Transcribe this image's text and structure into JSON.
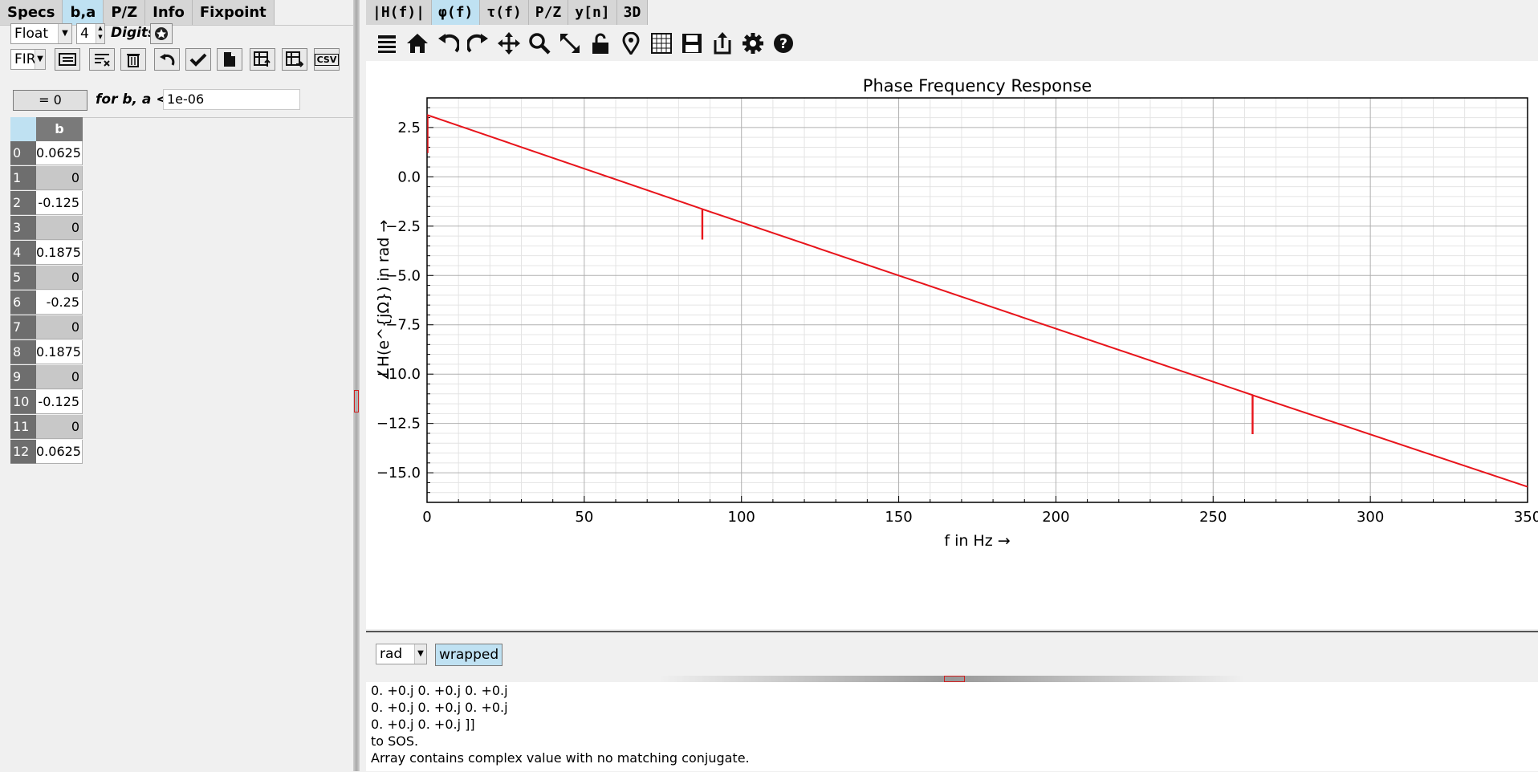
{
  "left_tabs": [
    {
      "label": "Specs",
      "active": false
    },
    {
      "label": "b,a",
      "active": true
    },
    {
      "label": "P/Z",
      "active": false
    },
    {
      "label": "Info",
      "active": false
    },
    {
      "label": "Fixpoint",
      "active": false
    }
  ],
  "format": {
    "selected": "Float",
    "digits": "4",
    "digits_label": "Digits"
  },
  "filter_type": {
    "selected": "FIR"
  },
  "zero": {
    "button_label": "= 0",
    "threshold_label": "for b, a <",
    "threshold_value": "1e-06",
    "csv_label": "CSV"
  },
  "coef_table": {
    "header": "b",
    "rows": [
      {
        "idx": "0",
        "b": "0.0625"
      },
      {
        "idx": "1",
        "b": "0"
      },
      {
        "idx": "2",
        "b": "-0.125"
      },
      {
        "idx": "3",
        "b": "0"
      },
      {
        "idx": "4",
        "b": "0.1875"
      },
      {
        "idx": "5",
        "b": "0"
      },
      {
        "idx": "6",
        "b": "-0.25"
      },
      {
        "idx": "7",
        "b": "0"
      },
      {
        "idx": "8",
        "b": "0.1875"
      },
      {
        "idx": "9",
        "b": "0"
      },
      {
        "idx": "10",
        "b": "-0.125"
      },
      {
        "idx": "11",
        "b": "0"
      },
      {
        "idx": "12",
        "b": "0.0625"
      }
    ]
  },
  "right_tabs": [
    {
      "label": "|H(f)|",
      "active": false
    },
    {
      "label": "φ(f)",
      "active": true
    },
    {
      "label": "τ(f)",
      "active": false
    },
    {
      "label": "P/Z",
      "active": false
    },
    {
      "label": "y[n]",
      "active": false
    },
    {
      "label": "3D",
      "active": false
    }
  ],
  "toolbar_icons": [
    "menu-icon",
    "home-icon",
    "undo-icon",
    "redo-icon",
    "pan-icon",
    "zoom-icon",
    "fullscreen-icon",
    "lock-icon",
    "pin-icon",
    "grid-icon",
    "save-icon",
    "export-icon",
    "settings-icon",
    "help-icon"
  ],
  "chart_data": {
    "type": "line",
    "title": "Phase Frequency Response",
    "xlabel": "f in Hz →",
    "ylabel": "∠H(e^{jΩ}) in rad →",
    "xlim": [
      0,
      350
    ],
    "ylim": [
      -16.5,
      4.0
    ],
    "xticks": [
      "0",
      "50",
      "100",
      "150",
      "200",
      "250",
      "300",
      "350"
    ],
    "yticks": [
      "2.5",
      "0.0",
      "−2.5",
      "−5.0",
      "−7.5",
      "−10.0",
      "−12.5",
      "−15.0"
    ],
    "grid": true,
    "series": [
      {
        "color": "#e8141b",
        "x": [
          0,
          87.5,
          87.5,
          87.6,
          87.6,
          262.5,
          262.5,
          262.6,
          262.6,
          350
        ],
        "y": [
          3.14,
          -1.63,
          -3.14,
          -3.14,
          -1.64,
          -11.06,
          -13.0,
          -13.0,
          -11.07,
          -15.71
        ]
      }
    ]
  },
  "options": {
    "unit": "rad",
    "wrapped_label": "wrapped"
  },
  "console_lines": [
    "0. +0.j 0. +0.j 0. +0.j",
    "0. +0.j 0. +0.j 0. +0.j",
    "0. +0.j 0. +0.j ]]",
    "to SOS.",
    "Array contains complex value with no matching conjugate."
  ]
}
